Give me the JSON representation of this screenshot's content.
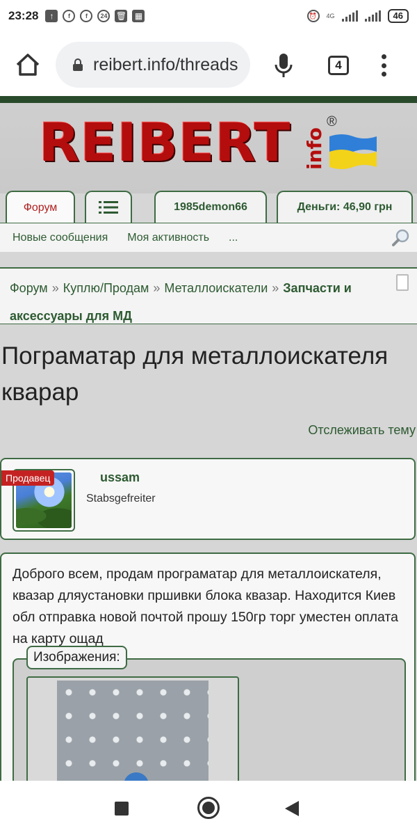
{
  "status_bar": {
    "time": "23:28",
    "icons": [
      "upload-icon",
      "facebook-icon",
      "facebook-icon",
      "24-badge-icon",
      "trash-icon",
      "calendar-icon"
    ],
    "notif_24": "24",
    "network": "4G",
    "battery": "46"
  },
  "browser": {
    "url": "reibert.info/threads",
    "tab_count": "4"
  },
  "site": {
    "logo_text": "REIBERT",
    "logo_suffix": "info",
    "logo_reg": "®"
  },
  "nav_tabs": {
    "forum": "Форум",
    "menu_icon": "list-icon",
    "user": "1985demon66",
    "money": "Деньги: 46,90 грн"
  },
  "subnav": {
    "new_messages": "Новые сообщения",
    "my_activity": "Моя активность",
    "more": "..."
  },
  "breadcrumbs": {
    "items": [
      "Форум",
      "Куплю/Продам",
      "Металлоискатели"
    ],
    "separator": "»",
    "last": "Запчасти и аксессуары для МД"
  },
  "thread": {
    "title": "Пограматар для металлоискателя кварар",
    "follow_link": "Отслеживать тему"
  },
  "post_author": {
    "badge": "Продавец",
    "username": "ussam",
    "rank": "Stabsgefreiter"
  },
  "post": {
    "body": "Доброго всем, продам програматар для металлоискателя, квазар дляустановки пршивки блока квазар. Находится Киев обл отправка новой почтой прошу 150гр торг уместен оплата на карту ощад",
    "attachments_label": "Изображения:"
  },
  "colors": {
    "accent_green": "#3e6b43",
    "link_green": "#2d5a31",
    "logo_red": "#b40d0d",
    "badge_red": "#c42222"
  }
}
